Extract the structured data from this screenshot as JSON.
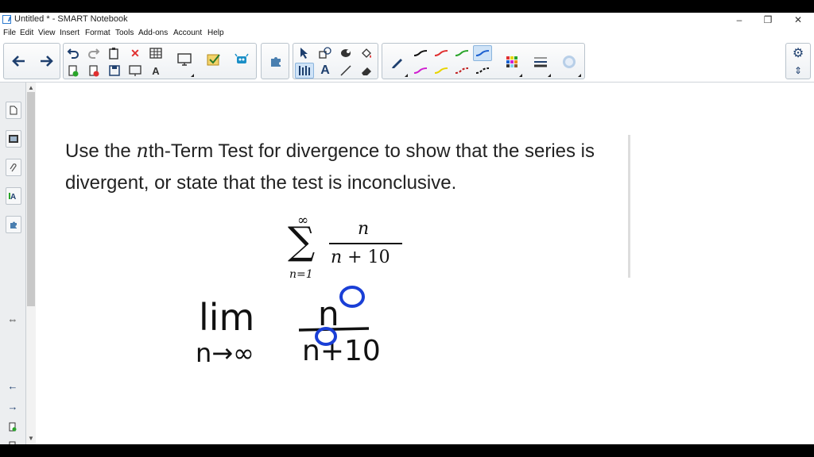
{
  "window": {
    "title": "Untitled * - SMART Notebook",
    "controls": [
      "–",
      "❐",
      "✕"
    ]
  },
  "menu": [
    "File",
    "Edit",
    "View",
    "Insert",
    "Format",
    "Tools",
    "Add-ons",
    "Account",
    "Help"
  ],
  "toolbar": {
    "nav": [
      "back-arrow-icon",
      "forward-arrow-icon"
    ],
    "edit_tools": [
      "undo-icon",
      "redo-icon",
      "paste-icon",
      "delete-icon",
      "table-icon",
      "add-page-icon",
      "remove-page-icon",
      "save-icon",
      "screen-shade-icon",
      "handwriting-icon"
    ],
    "pen_colors": [
      "#111111",
      "#e03030",
      "#2aa52a",
      "#1a5fd0",
      "#d01fd0",
      "#e8d400",
      "#c02020",
      "#111111"
    ],
    "selected_pen": 3
  },
  "content": {
    "question_part1": "Use the ",
    "question_var": "n",
    "question_part2": "th-Term Test for divergence to show that the series is divergent, or state that the test is inconclusive.",
    "series_upper": "∞",
    "series_sigma": "∑",
    "series_lower": "n=1",
    "series_numerator": "n",
    "series_denom_var": "n",
    "series_denom_rest": " + 10"
  },
  "annotations": {
    "lim": "lim",
    "lim_sub": "n→∞",
    "numerator": "n",
    "denominator": "n+10",
    "ink_color": "#111111",
    "highlight_color": "#1a3fd6"
  }
}
